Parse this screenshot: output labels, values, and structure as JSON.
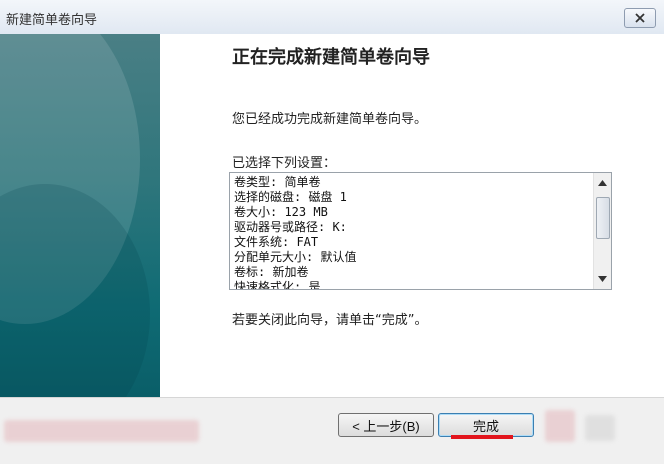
{
  "window": {
    "title": "新建简单卷向导"
  },
  "content": {
    "heading": "正在完成新建简单卷向导",
    "message": "您已经成功完成新建简单卷向导。",
    "settings_label": "已选择下列设置：",
    "settings": [
      "卷类型: 简单卷",
      "选择的磁盘: 磁盘 1",
      "卷大小: 123 MB",
      "驱动器号或路径: K:",
      "文件系统: FAT",
      "分配单元大小: 默认值",
      "卷标: 新加卷",
      "快速格式化: 是"
    ],
    "close_hint": "若要关闭此向导，请单击“完成”。"
  },
  "buttons": {
    "back": "< 上一步(B)",
    "finish": "完成"
  },
  "icons": {
    "close": "close-icon",
    "scroll_up": "scroll-up-arrow-icon",
    "scroll_down": "scroll-down-arrow-icon"
  },
  "colors": {
    "sidebar": "#1f6f76",
    "accent_underline": "#e2141c",
    "default_button_border": "#3c7fb1"
  }
}
